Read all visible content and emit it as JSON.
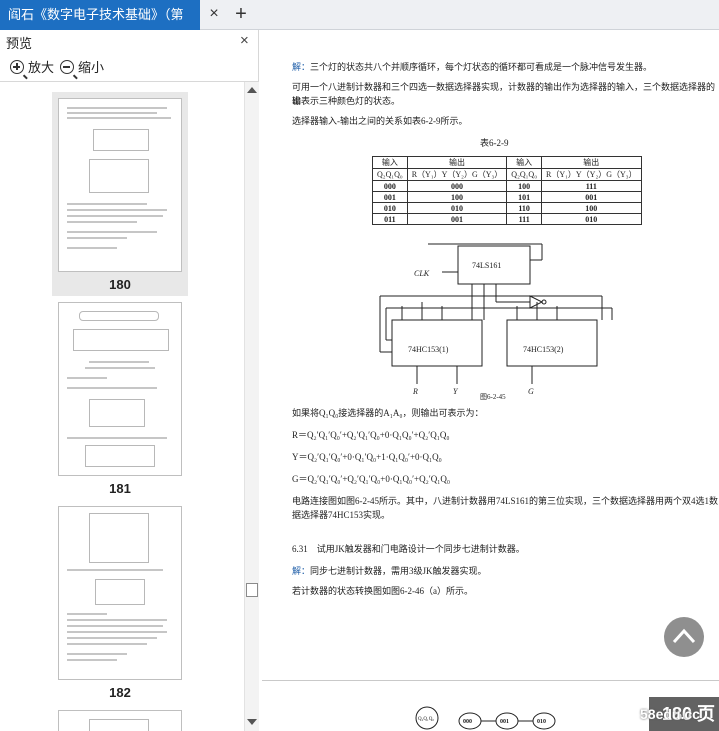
{
  "tab": {
    "title": "阎石《数字电子技术基础》（第"
  },
  "tab_close": "×",
  "tab_add": "+",
  "panel": {
    "title": "预览",
    "close": "×",
    "zoom_in": "放大",
    "zoom_out": "缩小"
  },
  "thumbnails": [
    {
      "page": "180"
    },
    {
      "page": "181"
    },
    {
      "page": "182"
    }
  ],
  "doc": {
    "line1_label": "解：",
    "line1": "三个灯的状态共八个并顺序循环，每个灯状态的循环都可看成是一个脉冲信号发生器。",
    "line2": "可用一个八进制计数器和三个四选一数据选择器实现，计数器的输出作为选择器的输入，三个数据选择器的输",
    "line3": "出表示三种颜色灯的状态。",
    "line4": "选择器输入-输出之间的关系如表6-2-9所示。",
    "table_title": "表6-2-9",
    "table_header": [
      "输入",
      "输出",
      "输入",
      "输出"
    ],
    "table_subheader": [
      "Q₂Q₁Q₀",
      "R（Y₁）Y（Y₂）G（Y₃）",
      "Q₂Q₁Q₀",
      "R（Y₁）Y（Y₂）G（Y₃）"
    ],
    "table_rows": [
      [
        "000",
        "000",
        "100",
        "111"
      ],
      [
        "001",
        "100",
        "101",
        "001"
      ],
      [
        "010",
        "010",
        "110",
        "100"
      ],
      [
        "011",
        "001",
        "111",
        "010"
      ]
    ],
    "circuit_labels": {
      "counter": "74LS161",
      "mux1": "74HC153(1)",
      "mux2": "74HC153(2)",
      "clk": "CLK",
      "r": "R",
      "y": "Y",
      "g": "G"
    },
    "figure_caption": "图6-2-45",
    "line5": "如果将Q₁Q₀接选择器的A₁A₀，则输出可表示为：",
    "eq_r": "R＝Q₂′Q₁′Q₀′+Q₂′Q₁′Q₀+0·Q₁Q₀′+Q₂′Q₁Q₀",
    "eq_y": "Y＝Q₂′Q₁′Q₀′+0·Q₁′Q₀+1·Q₁Q₀′+0·Q₁Q₀",
    "eq_g": "G＝Q₂′Q₁′Q₀′+Q₂′Q₁′Q₀+0·Q₁Q₀′+Q₂′Q₁Q₀",
    "line6": "电路连接图如图6-2-45所示。其中，八进制计数器用74LS161的第三位实现，三个数据选择器用两个双4选1数",
    "line7": "据选择器74HC153实现。",
    "q631": "6.31　试用JK触发器和门电路设计一个同步七进制计数器。",
    "ans_label": "解：",
    "ans": "同步七进制计数器，需用3级JK触发器实现。",
    "line8": "若计数器的状态转换图如图6-2-46（a）所示。",
    "state_labels": [
      "Q₂Q₁Q₀",
      "000",
      "001",
      "010"
    ]
  },
  "watermark": "58edu.cc",
  "current_page": "180 页",
  "colors": {
    "tab_active": "#1d6fc2",
    "answer_blue": "#1f5ea8"
  }
}
